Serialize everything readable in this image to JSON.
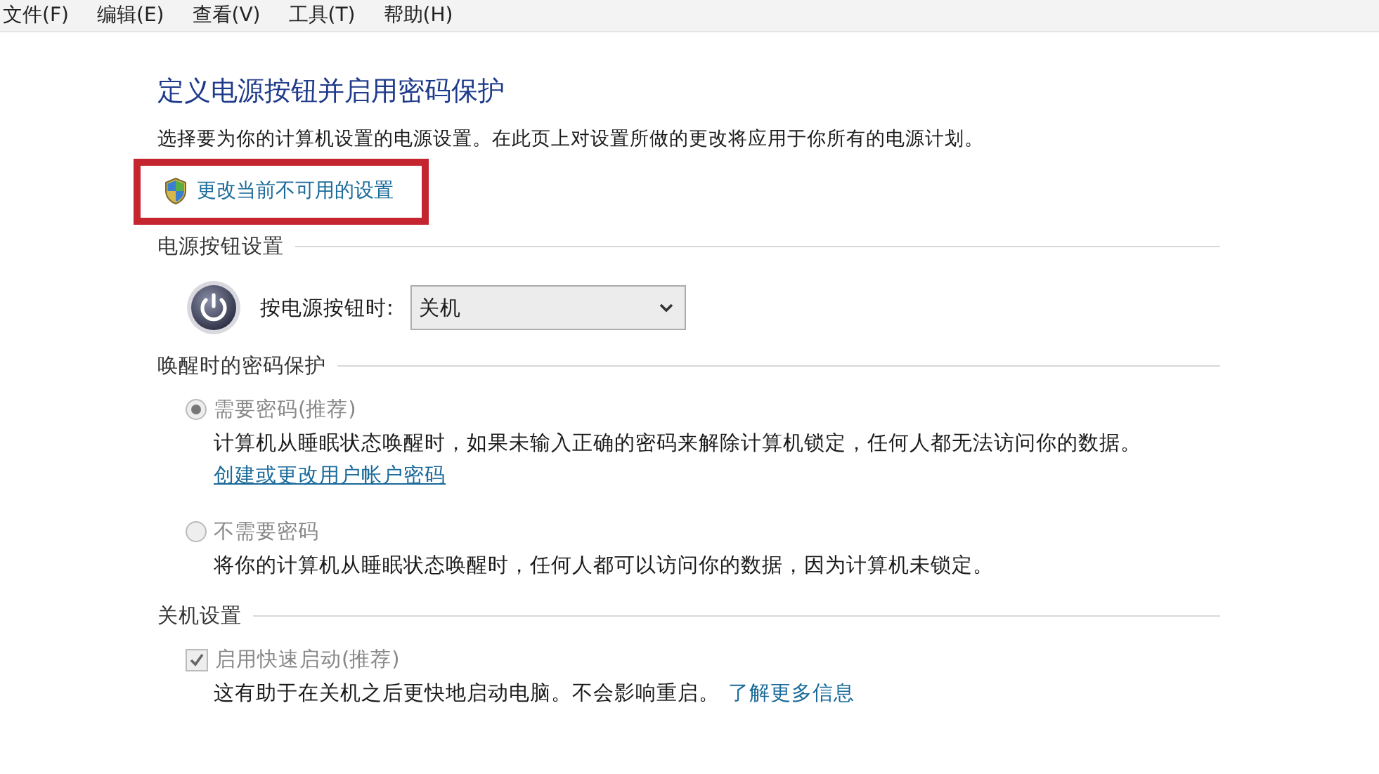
{
  "menu": [
    "文件(F)",
    "编辑(E)",
    "查看(V)",
    "工具(T)",
    "帮助(H)"
  ],
  "title": "定义电源按钮并启用密码保护",
  "description": "选择要为你的计算机设置的电源设置。在此页上对设置所做的更改将应用于你所有的电源计划。",
  "admin_link": {
    "text": "更改当前不可用的设置",
    "highlighted": true
  },
  "sections": [
    {
      "kind": "power",
      "heading": "电源按钮设置",
      "label": "按电源按钮时:",
      "value": "关机"
    },
    {
      "kind": "radios",
      "heading": "唤醒时的密码保护",
      "options": [
        {
          "label": "需要密码(推荐)",
          "selected": true,
          "disabled": true,
          "description": "计算机从睡眠状态唤醒时，如果未输入正确的密码来解除计算机锁定，任何人都无法访问你的数据。",
          "link": "创建或更改用户帐户密码"
        },
        {
          "label": "不需要密码",
          "selected": false,
          "disabled": true,
          "description": "将你的计算机从睡眠状态唤醒时，任何人都可以访问你的数据，因为计算机未锁定。"
        }
      ]
    },
    {
      "kind": "checkboxes",
      "heading": "关机设置",
      "options": [
        {
          "label": "启用快速启动(推荐)",
          "checked": true,
          "disabled": true,
          "description": "这有助于在关机之后更快地启动电脑。不会影响重启。",
          "link": "了解更多信息"
        }
      ]
    }
  ]
}
